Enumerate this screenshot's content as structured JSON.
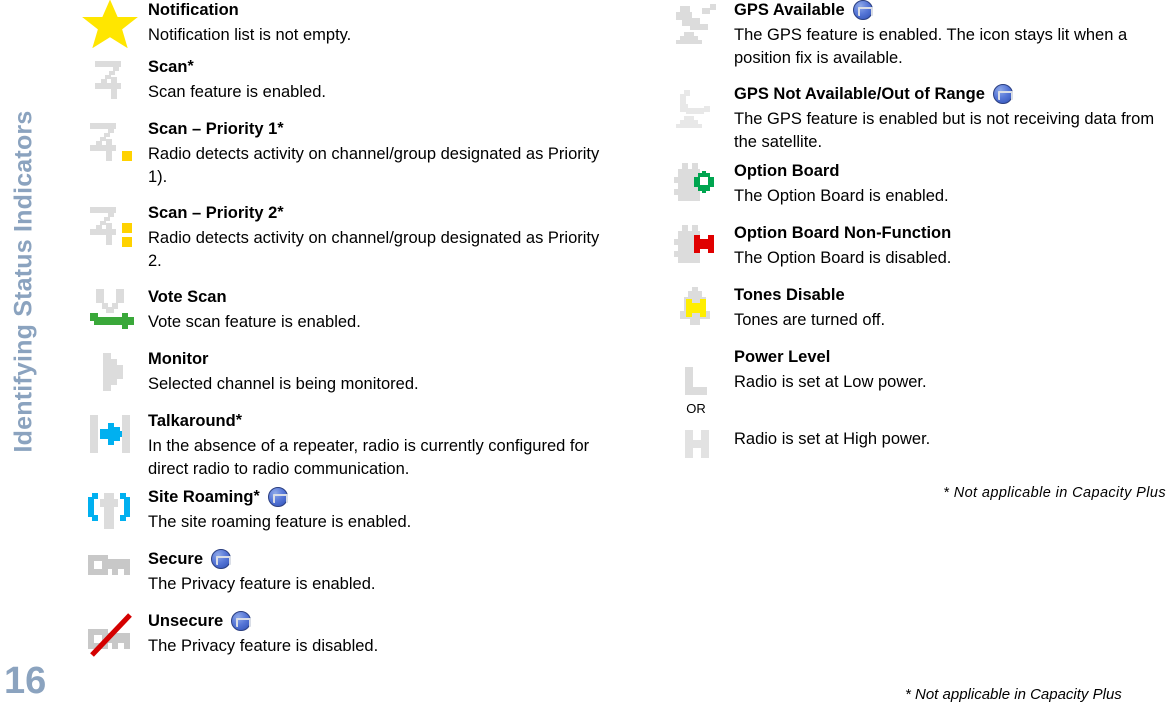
{
  "sidebar": {
    "running_head": "Identifying Status Indicators",
    "page_number": "16",
    "color": "#8ba3bf"
  },
  "footnotes": {
    "column_note": "* Not applicable in Capacity Plus",
    "page_note": "* Not applicable in Capacity Plus"
  },
  "left_column": [
    {
      "icon": "star-icon",
      "title": "Notification",
      "star": "",
      "description": "Notification list is not empty."
    },
    {
      "icon": "scan-icon",
      "title": "Scan",
      "star": "*",
      "description": "Scan feature is enabled."
    },
    {
      "icon": "scan-priority-1-icon",
      "title": "Scan – Priority 1",
      "star": "*",
      "description": "Radio detects activity on channel/group designated as Priority 1)."
    },
    {
      "icon": "scan-priority-2-icon",
      "title": "Scan – Priority 2 ",
      "star": "*",
      "description": "Radio detects activity on channel/group designated as Priority 2."
    },
    {
      "icon": "vote-scan-icon",
      "title": "Vote Scan",
      "star": "",
      "description": "Vote scan feature is enabled."
    },
    {
      "icon": "monitor-icon",
      "title": "Monitor",
      "star": "",
      "description": "Selected channel is being monitored."
    },
    {
      "icon": "talkaround-icon",
      "title": "Talkaround",
      "star": "*",
      "description": "In the absence of a repeater, radio is currently configured for direct radio to radio communication."
    },
    {
      "icon": "site-roaming-icon",
      "title": "Site Roaming",
      "star": "*",
      "badge": "capacity-plus-badge",
      "description": "The site roaming feature is enabled."
    },
    {
      "icon": "secure-key-icon",
      "title": "Secure",
      "star": "",
      "badge": "capacity-plus-badge",
      "description": "The Privacy feature is enabled."
    },
    {
      "icon": "unsecure-key-icon",
      "title": "Unsecure",
      "star": "",
      "badge": "capacity-plus-badge",
      "description": "The Privacy feature is disabled."
    }
  ],
  "right_column": [
    {
      "icon": "gps-available-icon",
      "title": "GPS Available",
      "badge": "capacity-plus-badge",
      "description": "The GPS feature is enabled. The icon stays lit when a position fix is available."
    },
    {
      "icon": "gps-not-available-icon",
      "title": "GPS Not Available/Out of Range",
      "badge": "capacity-plus-badge",
      "description": "The GPS feature is enabled but is not receiving data from the satellite."
    },
    {
      "icon": "option-board-icon",
      "title": "Option Board",
      "description": "The Option Board is enabled."
    },
    {
      "icon": "option-board-non-function-icon",
      "title": "Option Board Non-Function",
      "description": "The Option Board is disabled."
    },
    {
      "icon": "tones-disable-icon",
      "title": "Tones Disable",
      "description": "Tones are turned off."
    },
    {
      "icon": "power-level-low-icon",
      "title": "Power Level",
      "description": "Radio is set at Low power.",
      "or_label": "OR"
    },
    {
      "icon": "power-level-high-icon",
      "title": "",
      "description": "Radio is set at High power."
    }
  ],
  "colors": {
    "icon_grey": "#dcdcdc",
    "yellow": "#ffd200",
    "green": "#3aa83a",
    "cyan": "#00b0f0",
    "red": "#cc0000",
    "option_green": "#00a550",
    "tones_yellow": "#ffee00",
    "badge_blue": "#4466cc",
    "sidebar_blue": "#8ba3bf"
  }
}
